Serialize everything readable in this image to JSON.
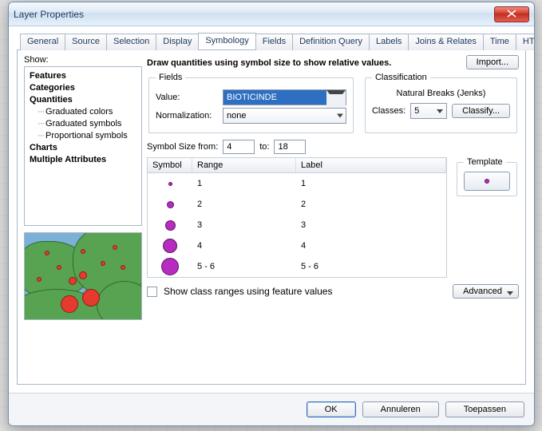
{
  "window": {
    "title": "Layer Properties"
  },
  "tabs": [
    "General",
    "Source",
    "Selection",
    "Display",
    "Symbology",
    "Fields",
    "Definition Query",
    "Labels",
    "Joins & Relates",
    "Time",
    "HTML Popup"
  ],
  "active_tab": "Symbology",
  "show": {
    "label": "Show:",
    "groups": [
      {
        "title": "Features"
      },
      {
        "title": "Categories"
      },
      {
        "title": "Quantities",
        "children": [
          "Graduated colors",
          "Graduated symbols",
          "Proportional symbols"
        ]
      },
      {
        "title": "Charts"
      },
      {
        "title": "Multiple Attributes"
      }
    ]
  },
  "description": "Draw quantities using symbol size to show relative values.",
  "buttons": {
    "import": "Import...",
    "classify": "Classify...",
    "advanced": "Advanced",
    "ok": "OK",
    "cancel": "Annuleren",
    "apply": "Toepassen"
  },
  "fields": {
    "legend": "Fields",
    "value_label": "Value:",
    "value": "BIOTICINDE",
    "norm_label": "Normalization:",
    "norm": "none"
  },
  "classification": {
    "legend": "Classification",
    "method": "Natural Breaks (Jenks)",
    "classes_label": "Classes:",
    "classes": "5"
  },
  "symbol_size": {
    "label_from": "Symbol Size from:",
    "from": "4",
    "label_to": "to:",
    "to": "18"
  },
  "table": {
    "headers": {
      "symbol": "Symbol",
      "range": "Range",
      "label": "Label"
    },
    "rows": [
      {
        "size": 5,
        "range": "1",
        "label": "1"
      },
      {
        "size": 9,
        "range": "2",
        "label": "2"
      },
      {
        "size": 13,
        "range": "3",
        "label": "3"
      },
      {
        "size": 18,
        "range": "4",
        "label": "4"
      },
      {
        "size": 22,
        "range": "5 - 6",
        "label": "5 - 6"
      }
    ]
  },
  "template": {
    "legend": "Template"
  },
  "show_ranges": {
    "label": "Show class ranges using feature values",
    "checked": false
  }
}
